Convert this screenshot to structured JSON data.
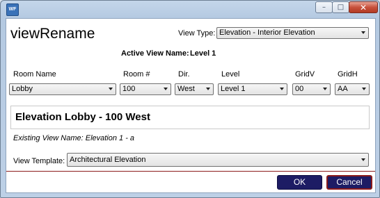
{
  "titlebar": {
    "icon_label": "WF",
    "minimize_symbol": "–",
    "maximize_symbol": "□",
    "close_symbol": "✕"
  },
  "heading": "viewRename",
  "view_type": {
    "label": "View Type:",
    "value": "Elevation - Interior Elevation"
  },
  "active_view": {
    "label": "Active View Name:",
    "value": "Level 1"
  },
  "fields": {
    "room_name": {
      "label": "Room Name",
      "value": "Lobby"
    },
    "room_number": {
      "label": "Room #",
      "value": "100"
    },
    "dir": {
      "label": "Dir.",
      "value": "West"
    },
    "level": {
      "label": "Level",
      "value": "Level 1"
    },
    "gridv": {
      "label": "GridV",
      "value": "00"
    },
    "gridh": {
      "label": "GridH",
      "value": "AA"
    }
  },
  "new_view_name": "Elevation Lobby - 100 West",
  "existing_view_name": "Existing View Name: Elevation 1 - a",
  "view_template": {
    "label": "View Template:",
    "value": "Architectural Elevation"
  },
  "buttons": {
    "ok": "OK",
    "cancel": "Cancel"
  }
}
